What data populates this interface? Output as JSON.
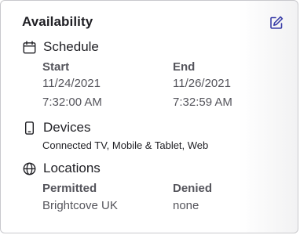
{
  "availability": {
    "title": "Availability",
    "schedule": {
      "heading": "Schedule",
      "start_label": "Start",
      "start_date": "11/24/2021",
      "start_time": "7:32:00 AM",
      "end_label": "End",
      "end_date": "11/26/2021",
      "end_time": "7:32:59 AM"
    },
    "devices": {
      "heading": "Devices",
      "list": "Connected TV, Mobile & Tablet, Web"
    },
    "locations": {
      "heading": "Locations",
      "permitted_label": "Permitted",
      "permitted_value": "Brightcove UK",
      "denied_label": "Denied",
      "denied_value": "none"
    },
    "icons": {
      "edit": "edit-icon",
      "schedule": "calendar-icon",
      "devices": "mobile-device-icon",
      "locations": "globe-icon"
    },
    "colors": {
      "accent": "#3b3fa8",
      "text_primary": "#1f1f24",
      "text_secondary": "#55555c"
    }
  }
}
